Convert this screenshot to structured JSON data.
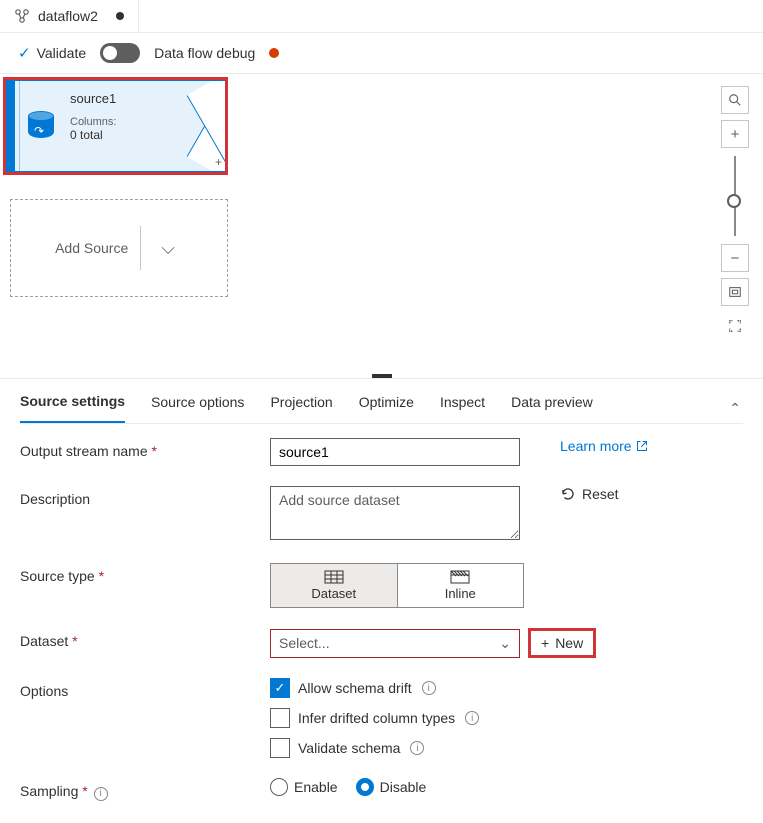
{
  "tab": {
    "title": "dataflow2"
  },
  "toolbar": {
    "validate": "Validate",
    "debug_label": "Data flow debug"
  },
  "canvas": {
    "source": {
      "name": "source1",
      "columns_label": "Columns:",
      "columns_total": "0 total"
    },
    "add_source": "Add Source"
  },
  "panel": {
    "tabs": {
      "source_settings": "Source settings",
      "source_options": "Source options",
      "projection": "Projection",
      "optimize": "Optimize",
      "inspect": "Inspect",
      "data_preview": "Data preview"
    },
    "output_stream": {
      "label": "Output stream name",
      "value": "source1"
    },
    "description": {
      "label": "Description",
      "placeholder": "Add source dataset"
    },
    "learn_more": "Learn more",
    "reset": "Reset",
    "source_type": {
      "label": "Source type",
      "dataset": "Dataset",
      "inline": "Inline"
    },
    "dataset": {
      "label": "Dataset",
      "placeholder": "Select...",
      "new": "New"
    },
    "options": {
      "label": "Options",
      "allow_drift": "Allow schema drift",
      "infer_drifted": "Infer drifted column types",
      "validate_schema": "Validate schema"
    },
    "sampling": {
      "label": "Sampling",
      "enable": "Enable",
      "disable": "Disable"
    }
  }
}
